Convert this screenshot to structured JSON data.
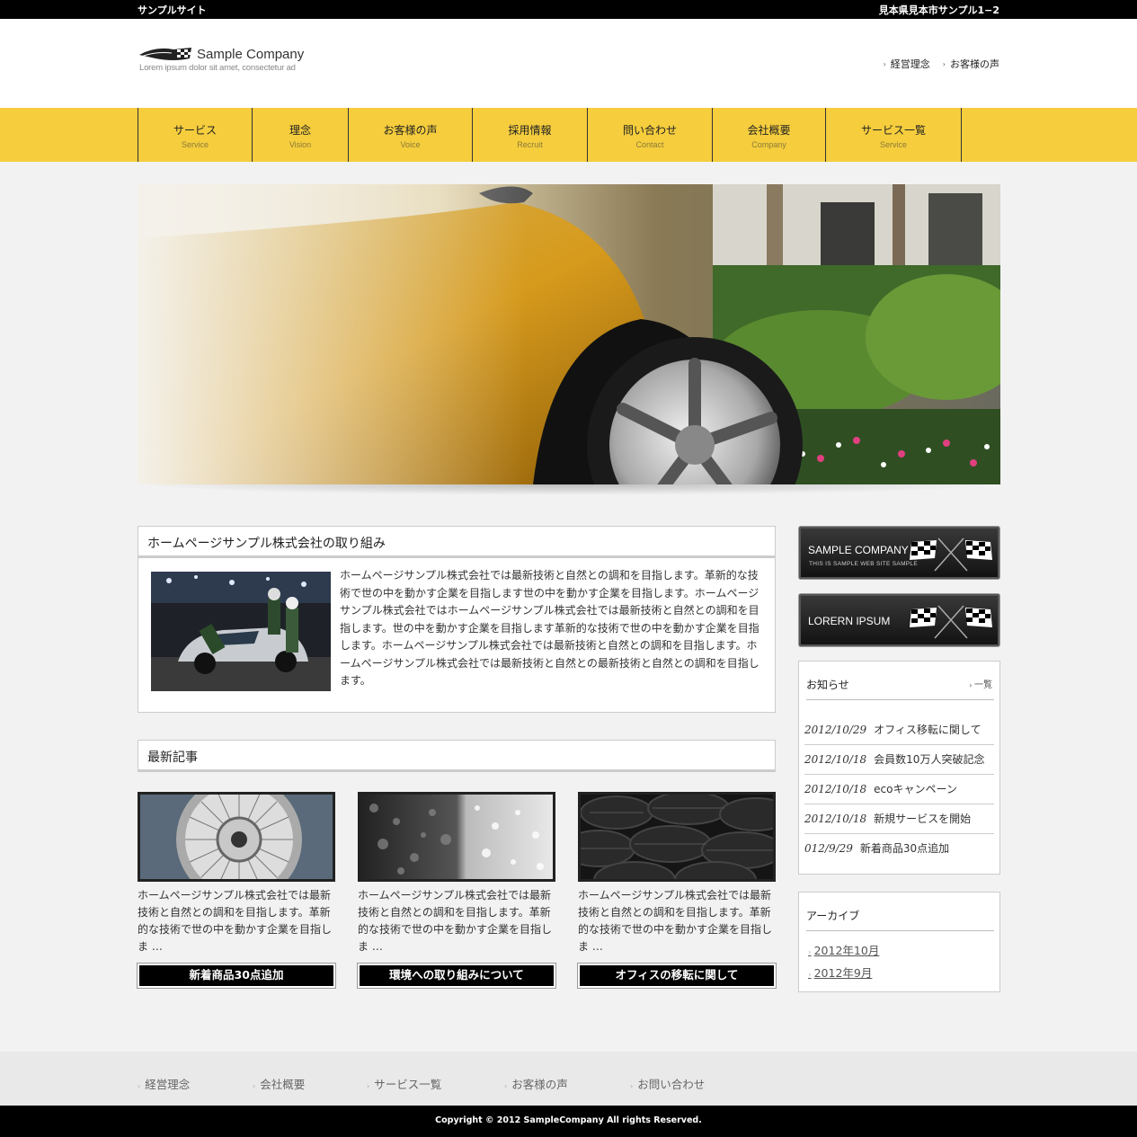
{
  "topbar": {
    "site_name": "サンプルサイト",
    "address": "見本県見本市サンプル1−2"
  },
  "header": {
    "company_name": "Sample Company",
    "tagline": "Lorem ipsum dolor sit amet, consectetur ad",
    "links": [
      "経営理念",
      "お客様の声"
    ]
  },
  "nav": [
    {
      "jp": "サービス",
      "en": "Service"
    },
    {
      "jp": "理念",
      "en": "Vision"
    },
    {
      "jp": "お客様の声",
      "en": "Voice"
    },
    {
      "jp": "採用情報",
      "en": "Recruit"
    },
    {
      "jp": "問い合わせ",
      "en": "Contact"
    },
    {
      "jp": "会社概要",
      "en": "Company"
    },
    {
      "jp": "サービス一覧",
      "en": "Service"
    }
  ],
  "intro": {
    "title": "ホームページサンプル株式会社の取り組み",
    "text": "ホームページサンプル株式会社では最新技術と自然との調和を目指します。革新的な技術で世の中を動かす企業を目指します世の中を動かす企業を目指します。ホームページサンプル株式会社ではホームページサンプル株式会社では最新技術と自然との調和を目指します。世の中を動かす企業を目指します革新的な技術で世の中を動かす企業を目指します。ホームページサンプル株式会社では最新技術と自然との調和を目指します。ホームページサンプル株式会社では最新技術と自然との最新技術と自然との調和を目指します。"
  },
  "latest": {
    "title": "最新記事",
    "articles": [
      {
        "text": "ホームページサンプル株式会社では最新技術と自然との調和を目指します。革新的な技術で世の中を動かす企業を目指しま …",
        "button": "新着商品30点追加"
      },
      {
        "text": "ホームページサンプル株式会社では最新技術と自然との調和を目指します。革新的な技術で世の中を動かす企業を目指しま …",
        "button": "環境への取り組みについて"
      },
      {
        "text": "ホームページサンプル株式会社では最新技術と自然との調和を目指します。革新的な技術で世の中を動かす企業を目指しま …",
        "button": "オフィスの移転に関して"
      }
    ]
  },
  "sidebar": {
    "banner1": {
      "title": "SAMPLE COMPANY",
      "subtitle": "THIS IS SAMPLE WEB SITE SAMPLE"
    },
    "banner2": {
      "title": "LORERN IPSUM"
    },
    "news": {
      "title": "お知らせ",
      "more": "一覧",
      "items": [
        {
          "date": "2012/10/29",
          "text": "オフィス移転に関して"
        },
        {
          "date": "2012/10/18",
          "text": "会員数10万人突破記念"
        },
        {
          "date": "2012/10/18",
          "text": "ecoキャンペーン"
        },
        {
          "date": "2012/10/18",
          "text": "新規サービスを開始"
        },
        {
          "date": "012/9/29",
          "text": "新着商品30点追加"
        }
      ]
    },
    "archive": {
      "title": "アーカイブ",
      "items": [
        "2012年10月",
        "2012年9月"
      ]
    }
  },
  "footer": {
    "links": [
      "経営理念",
      "会社概要",
      "サービス一覧",
      "お客様の声",
      "お問い合わせ"
    ],
    "copyright": "Copyright © 2012 SampleCompany All rights Reserved."
  },
  "colors": {
    "nav_bg": "#f5cd3d",
    "topbar_bg": "#000000",
    "page_bg": "#f2f2f2"
  }
}
